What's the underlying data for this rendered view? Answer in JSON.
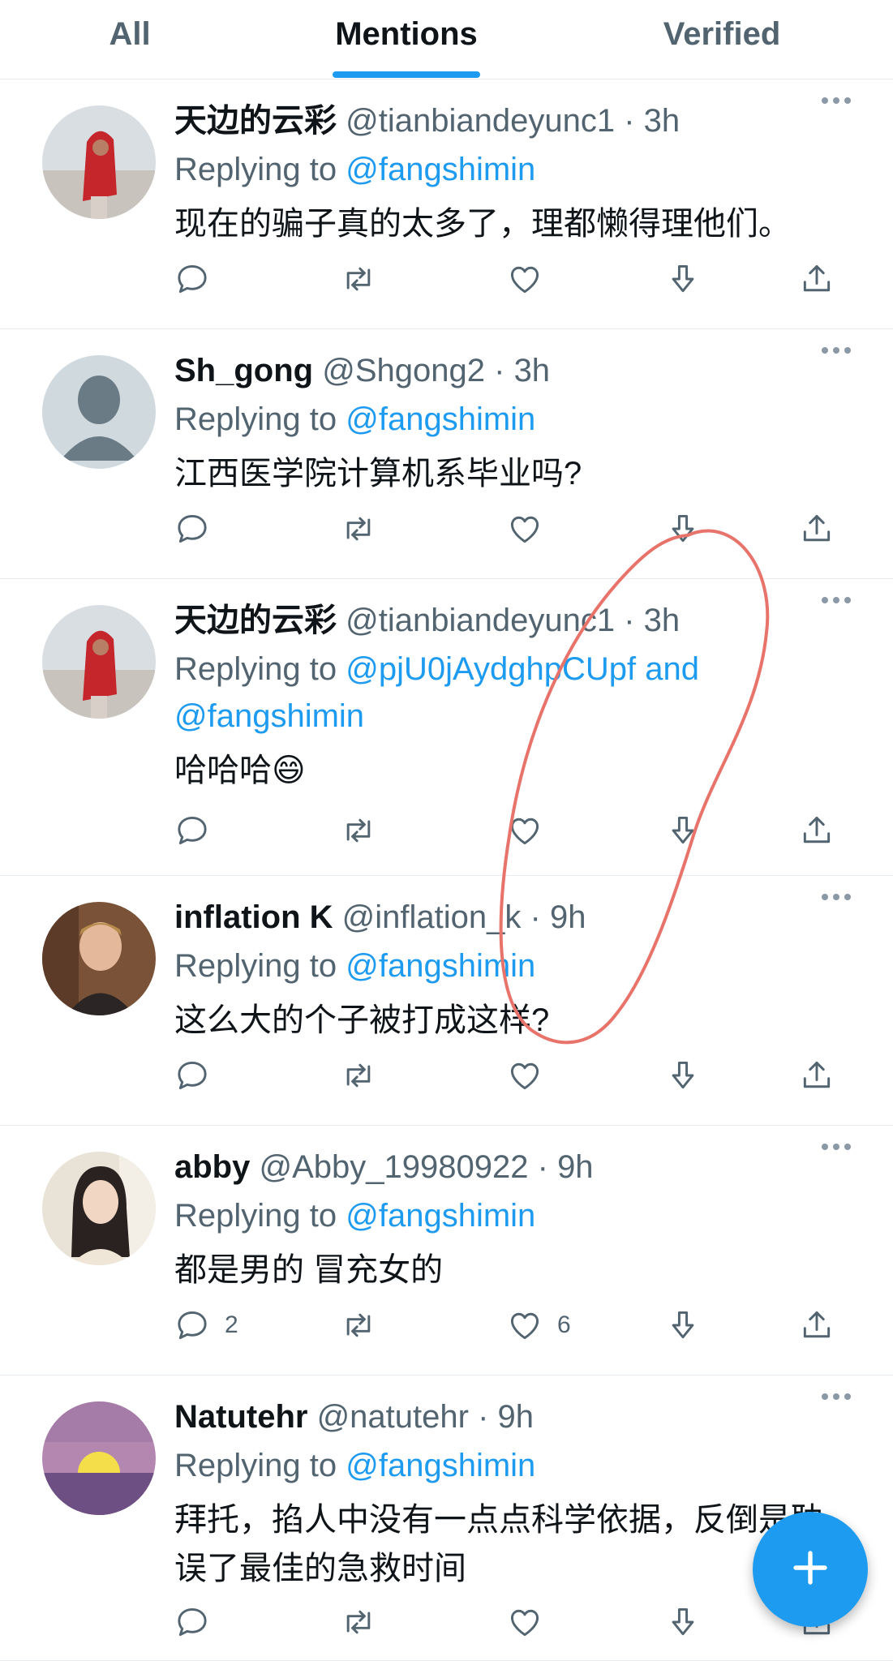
{
  "tabs": [
    {
      "label": "All",
      "active": false
    },
    {
      "label": "Mentions",
      "active": true
    },
    {
      "label": "Verified",
      "active": false
    }
  ],
  "tweets": [
    {
      "name": "天边的云彩",
      "handle": "@tianbiandeyunc1",
      "sep": "·",
      "time": "3h",
      "reply_prefix": "Replying to",
      "mentions": "@fangshimin",
      "mentions_line2": "",
      "text": "现在的骗子真的太多了，理都懒得理他们。",
      "text_line2": "",
      "reply_count": "",
      "like_count": "",
      "avatar": "red-scarf-photo"
    },
    {
      "name": "Sh_gong",
      "handle": "@Shgong2",
      "sep": "·",
      "time": "3h",
      "reply_prefix": "Replying to",
      "mentions": "@fangshimin",
      "mentions_line2": "",
      "text": "江西医学院计算机系毕业吗?",
      "text_line2": "",
      "reply_count": "",
      "like_count": "",
      "avatar": "default-person"
    },
    {
      "name": "天边的云彩",
      "handle": "@tianbiandeyunc1",
      "sep": "·",
      "time": "3h",
      "reply_prefix": "Replying to",
      "mentions": "@pjU0jAydghpCUpf and",
      "mentions_line2": "@fangshimin",
      "text": "哈哈哈😄",
      "text_line2": "",
      "reply_count": "",
      "like_count": "",
      "avatar": "red-scarf-photo"
    },
    {
      "name": "inflation K",
      "handle": "@inflation_k",
      "sep": "·",
      "time": "9h",
      "reply_prefix": "Replying to",
      "mentions": "@fangshimin",
      "mentions_line2": "",
      "text": "这么大的个子被打成这样?",
      "text_line2": "",
      "reply_count": "",
      "like_count": "",
      "avatar": "young-man-photo"
    },
    {
      "name": "abby",
      "handle": "@Abby_19980922",
      "sep": "·",
      "time": "9h",
      "reply_prefix": "Replying to",
      "mentions": "@fangshimin",
      "mentions_line2": "",
      "text": "都是男的 冒充女的",
      "text_line2": "",
      "reply_count": "2",
      "like_count": "6",
      "avatar": "woman-photo"
    },
    {
      "name": "Natutehr",
      "handle": "@natutehr",
      "sep": "·",
      "time": "9h",
      "reply_prefix": "Replying to",
      "mentions": "@fangshimin",
      "mentions_line2": "",
      "text": "拜托，掐人中没有一点点科学依据，反倒是耽",
      "text_line2": "误了最佳的急救时间",
      "reply_count": "",
      "like_count": "",
      "avatar": "sunset-photo"
    }
  ],
  "colors": {
    "accent": "#1d9bf0",
    "secondary_text": "#536471",
    "annotation": "#e8736a"
  },
  "icons": [
    "reply-icon",
    "retweet-icon",
    "like-icon",
    "downvote-icon",
    "share-icon",
    "more-icon",
    "compose-plus-icon"
  ]
}
